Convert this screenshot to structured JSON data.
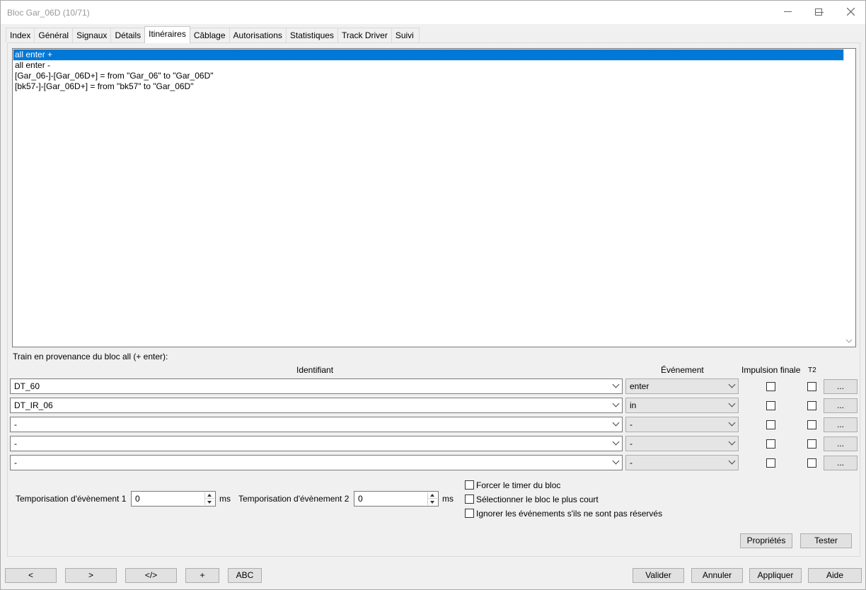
{
  "window": {
    "title": "Bloc Gar_06D (10/71)"
  },
  "tabs": [
    {
      "label": "Index"
    },
    {
      "label": "Général"
    },
    {
      "label": "Signaux"
    },
    {
      "label": "Détails"
    },
    {
      "label": "Itinéraires"
    },
    {
      "label": "Câblage"
    },
    {
      "label": "Autorisations"
    },
    {
      "label": "Statistiques"
    },
    {
      "label": "Track Driver"
    },
    {
      "label": "Suivi"
    }
  ],
  "routes": [
    "all enter +",
    "all enter -",
    "[Gar_06-]-[Gar_06D+] = from \"Gar_06\" to \"Gar_06D\"",
    "[bk57-]-[Gar_06D+] = from \"bk57\" to \"Gar_06D\""
  ],
  "section_label": "Train en provenance du bloc all (+ enter):",
  "columns": {
    "identifiant": "Identifiant",
    "evenement": "Événement",
    "impulsion": "Impulsion finale",
    "t2": "T2"
  },
  "rows": [
    {
      "id": "DT_60",
      "event": "enter",
      "more": "..."
    },
    {
      "id": "DT_IR_06",
      "event": "in",
      "more": "..."
    },
    {
      "id": "-",
      "event": "-",
      "more": "..."
    },
    {
      "id": "-",
      "event": "-",
      "more": "..."
    },
    {
      "id": "-",
      "event": "-",
      "more": "..."
    }
  ],
  "timers": {
    "t1_label": "Temporisation d'évènement 1",
    "t1_value": "0",
    "t2_label": "Temporisation d'évènement 2",
    "t2_value": "0",
    "unit": "ms"
  },
  "options": [
    "Forcer le timer du bloc",
    "Sélectionner le bloc le plus court",
    "Ignorer les événements s'ils ne sont pas réservés"
  ],
  "panel_buttons": {
    "properties": "Propriétés",
    "test": "Tester"
  },
  "bottom_left": [
    "<",
    ">",
    "</>",
    "+",
    "ABC"
  ],
  "bottom_right": [
    "Valider",
    "Annuler",
    "Appliquer",
    "Aide"
  ]
}
